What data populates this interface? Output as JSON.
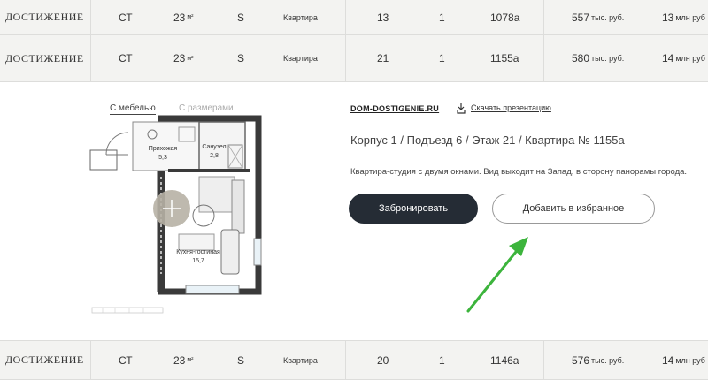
{
  "rows": [
    {
      "logo": "ДОСТИЖЕНИЕ",
      "type": "СТ",
      "area": "23",
      "area_unit": "м²",
      "orientation": "S",
      "kind": "Квартира",
      "floor": "13",
      "rooms": "1",
      "number": "1078а",
      "price_m2": "557",
      "price_m2_unit": "тыс. руб.",
      "price": "13",
      "price_unit": "млн руб"
    },
    {
      "logo": "ДОСТИЖЕНИЕ",
      "type": "СТ",
      "area": "23",
      "area_unit": "м²",
      "orientation": "S",
      "kind": "Квартира",
      "floor": "21",
      "rooms": "1",
      "number": "1155а",
      "price_m2": "580",
      "price_m2_unit": "тыс. руб.",
      "price": "14",
      "price_unit": "млн руб"
    },
    {
      "logo": "ДОСТИЖЕНИЕ",
      "type": "СТ",
      "area": "23",
      "area_unit": "м²",
      "orientation": "S",
      "kind": "Квартира",
      "floor": "20",
      "rooms": "1",
      "number": "1146а",
      "price_m2": "576",
      "price_m2_unit": "тыс. руб.",
      "price": "14",
      "price_unit": "млн руб"
    }
  ],
  "plan": {
    "tab_furniture": "С мебелью",
    "tab_dimensions": "С размерами",
    "room_hall": "Прихожая",
    "room_hall_area": "5,3",
    "room_bath": "Санузел",
    "room_bath_area": "2,8",
    "room_kitchen": "Кухня-гостиная",
    "room_kitchen_area": "15,7"
  },
  "details": {
    "site": "DOM-DOSTIGENIE.RU",
    "download": "Скачать презентацию",
    "address": "Корпус 1 / Подъезд 6 / Этаж 21 / Квартира № 1155а",
    "description": "Квартира-студия с двумя окнами. Вид выходит на Запад, в сторону панорамы города.",
    "book_button": "Забронировать",
    "favorite_button": "Добавить в избранное"
  },
  "colors": {
    "dark_button": "#252c35",
    "arrow": "#3cb43c",
    "row_bg": "#f3f3f1"
  }
}
